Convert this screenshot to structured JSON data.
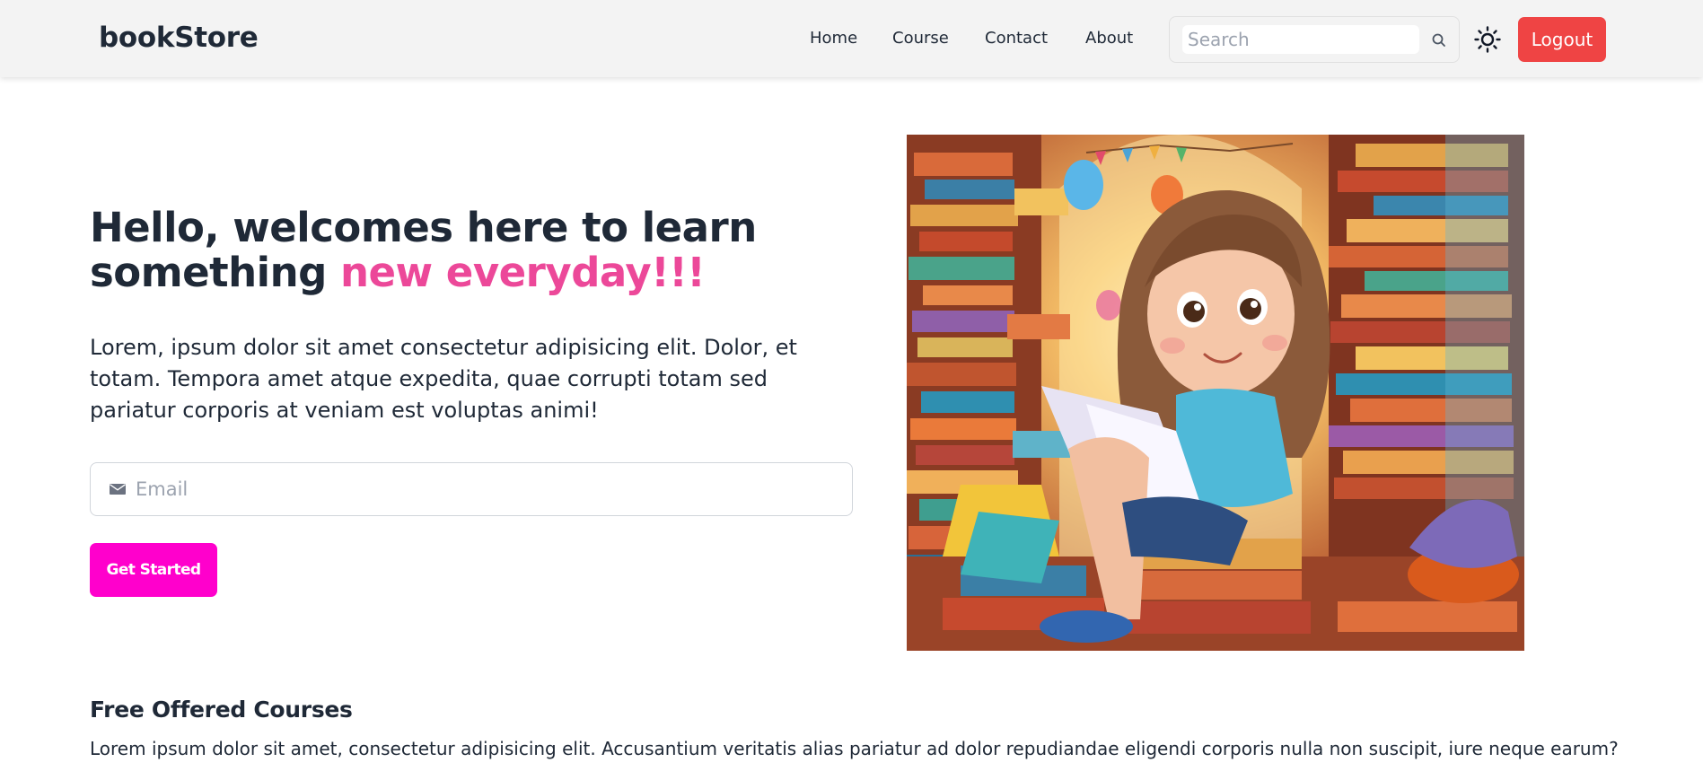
{
  "navbar": {
    "brand": "bookStore",
    "links": [
      "Home",
      "Course",
      "Contact",
      "About"
    ],
    "search_placeholder": "Search",
    "theme_icon": "sun-icon",
    "logout_label": "Logout",
    "logout_color": "#ef4444"
  },
  "hero": {
    "title_main": "Hello, welcomes here to learn something ",
    "title_accent": "new everyday!!!",
    "accent_color": "#ec4899",
    "description": "Lorem, ipsum dolor sit amet consectetur adipisicing elit. Dolor, et totam. Tempora amet atque expedita, quae corrupti totam sed pariatur corporis at veniam est voluptas animi!",
    "email_placeholder": "Email",
    "email_icon": "envelope-icon",
    "cta_label": "Get Started",
    "cta_color": "#ff00cc"
  },
  "courses": {
    "title": "Free Offered Courses",
    "description": "Lorem ipsum dolor sit amet, consectetur adipisicing elit. Accusantium veritatis alias pariatur ad dolor repudiandae eligendi corporis nulla non suscipit, iure neque earum?"
  }
}
